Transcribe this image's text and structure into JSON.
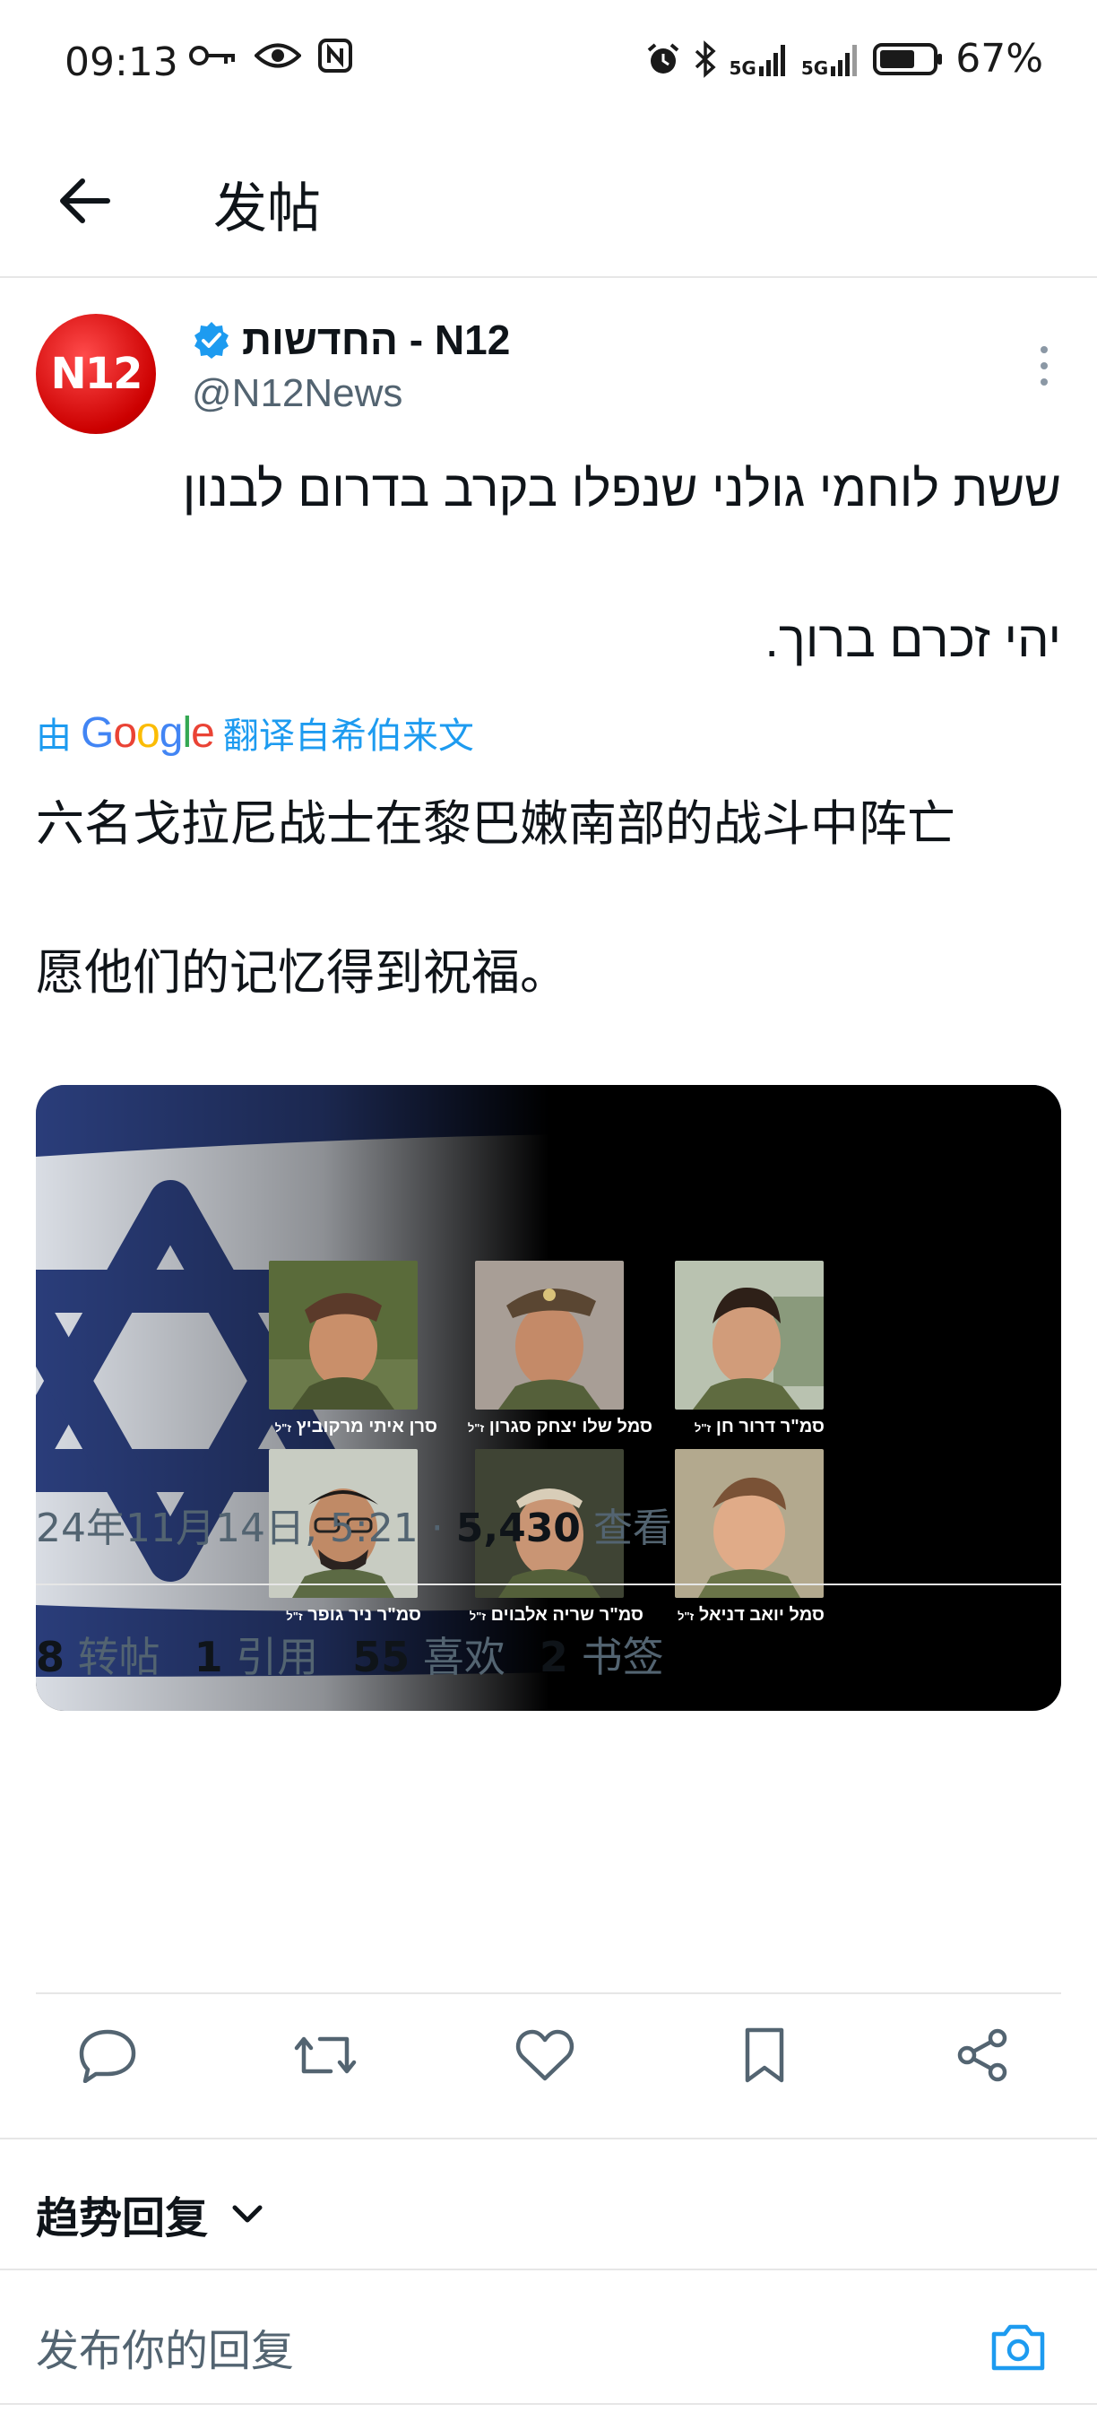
{
  "status_bar": {
    "time": "09:13",
    "battery": "67%",
    "net1": "5G",
    "net2": "5G"
  },
  "header": {
    "title": "发帖"
  },
  "tweet": {
    "avatar_text": "N12",
    "display_name": "החדשות - N12",
    "handle": "@N12News",
    "text_he_1": "ששת לוחמי גולני שנפלו בקרב בדרום לבנון",
    "text_he_2": "יהי זכרם ברוך.",
    "translate_prefix": "由",
    "translate_brand": "Google",
    "translate_suffix": "翻译自希伯来文",
    "text_cn_1": "六名戈拉尼战士在黎巴嫩南部的战斗中阵亡",
    "text_cn_2": "愿他们的记忆得到祝福。",
    "soldiers": [
      {
        "name": "סרן איתי מרקוביץ",
        "suffix": "ז\"ל"
      },
      {
        "name": "סמל שלו יצחק סגרון",
        "suffix": "ז\"ל"
      },
      {
        "name": "סמ\"ר דרור חן",
        "suffix": "ז\"ל"
      },
      {
        "name": "סמ\"ר ניר גופר",
        "suffix": "ז\"ל"
      },
      {
        "name": "סמ\"ר שריה אלבוים",
        "suffix": "ז\"ל"
      },
      {
        "name": "סמל יואב דניאל",
        "suffix": "ז\"ל"
      }
    ],
    "meta": {
      "datetime": "24年11月14日, 5:21",
      "separator": "·",
      "views": "5,430",
      "views_label": "查看"
    },
    "stats": [
      {
        "count": "8",
        "label": "转帖"
      },
      {
        "count": "1",
        "label": "引用"
      },
      {
        "count": "55",
        "label": "喜欢"
      },
      {
        "count": "2",
        "label": "书签"
      }
    ]
  },
  "trending": {
    "label": "趋势回复"
  },
  "reply": {
    "placeholder": "发布你的回复"
  },
  "colors": {
    "accent": "#1d9bf0",
    "verified": "#1d9bf0",
    "secondary_text": "#536471"
  }
}
